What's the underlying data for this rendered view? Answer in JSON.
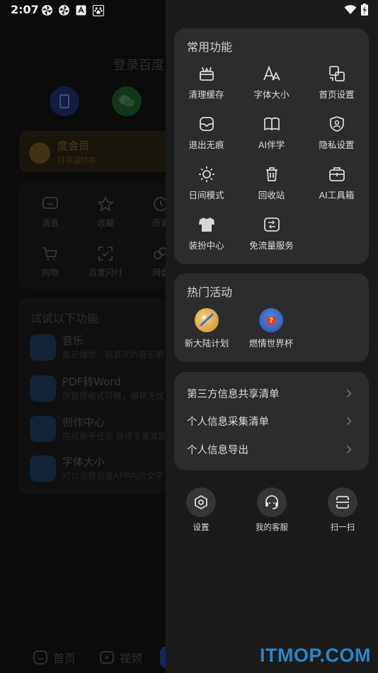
{
  "status_bar": {
    "time": "2:07",
    "left_icons": [
      "pinwheel-icon",
      "pinwheel-icon",
      "app-a-icon",
      "baidu-paw-icon"
    ],
    "right_icons": [
      "wifi-icon",
      "battery-charging-icon"
    ]
  },
  "background": {
    "login_text": "登录百度",
    "member": {
      "title": "度会员",
      "subtitle": "特享福特换"
    },
    "grid": [
      {
        "label": "消息",
        "icon": "message-icon"
      },
      {
        "label": "收藏",
        "icon": "star-icon"
      },
      {
        "label": "历史",
        "icon": "clock-icon"
      },
      {
        "label": "购物",
        "icon": "cart-icon"
      },
      {
        "label": "百度闪付",
        "icon": "scan-pay-icon"
      },
      {
        "label": "网盘",
        "icon": "cloud-drive-icon"
      }
    ],
    "try_title": "试试以下功能",
    "features": [
      {
        "title": "音乐",
        "subtitle": "最近播放，我喜欢的音乐都"
      },
      {
        "title": "PDF转Word",
        "subtitle": "保留原格式转换，编辑无忧"
      },
      {
        "title": "创作中心",
        "subtitle": "完成新手任务 获得专属奖励"
      },
      {
        "title": "字体大小",
        "subtitle": "可以调整百度APP内的文字"
      }
    ],
    "tabs": [
      {
        "label": "首页",
        "icon": "home-icon"
      },
      {
        "label": "视频",
        "icon": "video-icon"
      }
    ]
  },
  "drawer": {
    "common": {
      "title": "常用功能",
      "items": [
        {
          "label": "清理缓存",
          "icon": "clean-cache-icon"
        },
        {
          "label": "字体大小",
          "icon": "font-size-icon"
        },
        {
          "label": "首页设置",
          "icon": "home-settings-icon"
        },
        {
          "label": "退出无痕",
          "icon": "incognito-icon"
        },
        {
          "label": "AI伴学",
          "icon": "ai-study-icon"
        },
        {
          "label": "隐私设置",
          "icon": "privacy-shield-icon"
        },
        {
          "label": "日间模式",
          "icon": "sun-icon"
        },
        {
          "label": "回收站",
          "icon": "trash-icon"
        },
        {
          "label": "AI工具箱",
          "icon": "ai-toolbox-icon"
        },
        {
          "label": "装扮中心",
          "icon": "tshirt-icon"
        },
        {
          "label": "免流量服务",
          "icon": "data-free-icon"
        }
      ]
    },
    "activities": {
      "title": "热门活动",
      "items": [
        {
          "label": "新大陆计划",
          "icon": "new-continent-icon"
        },
        {
          "label": "燃情世界杯",
          "icon": "world-cup-icon"
        }
      ]
    },
    "links": [
      {
        "label": "第三方信息共享清单"
      },
      {
        "label": "个人信息采集清单"
      },
      {
        "label": "个人信息导出"
      }
    ],
    "bottom": [
      {
        "label": "设置",
        "icon": "settings-hexagon-icon"
      },
      {
        "label": "我的客服",
        "icon": "customer-service-icon"
      },
      {
        "label": "扫一扫",
        "icon": "scan-icon"
      }
    ]
  },
  "watermark": "ITMOP.COM"
}
